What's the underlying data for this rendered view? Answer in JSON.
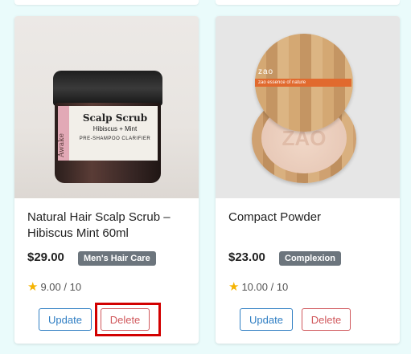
{
  "products": [
    {
      "title": "Natural Hair Scalp Scrub – Hibiscus Mint 60ml",
      "price": "$29.00",
      "category": "Men's Hair Care",
      "rating": "9.00 / 10",
      "update_label": "Update",
      "delete_label": "Delete",
      "image_label": {
        "brand": "Awake",
        "name": "Scalp Scrub",
        "sub": "Hibiscus + Mint",
        "line": "PRE-SHAMPOO CLARIFIER"
      }
    },
    {
      "title": "Compact Powder",
      "price": "$23.00",
      "category": "Complexion",
      "rating": "10.00 / 10",
      "update_label": "Update",
      "delete_label": "Delete",
      "image_label": {
        "brand": "zao",
        "strip": "zao   essence of nature",
        "pan_text": "ZAO"
      }
    }
  ],
  "colors": {
    "page_background": "#eafbfb",
    "update_button": "#2f7ec3",
    "delete_button": "#d0585c",
    "badge": "#6c757d",
    "star": "#f5b301",
    "highlight_box": "#d20000"
  },
  "icons": {
    "rating": "star-icon"
  }
}
